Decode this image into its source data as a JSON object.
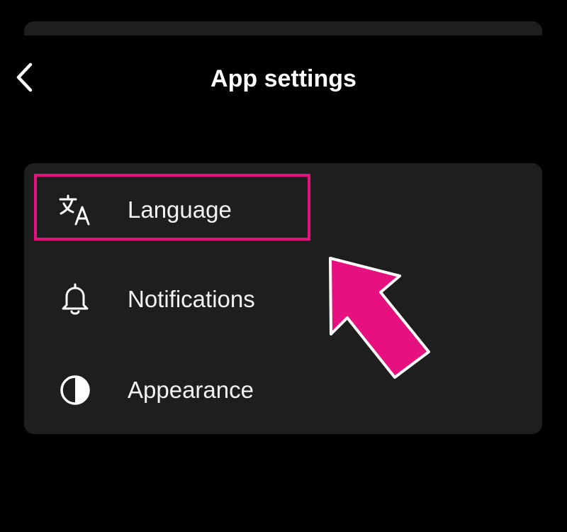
{
  "header": {
    "title": "App settings",
    "back_icon": "chevron-left-icon"
  },
  "settings": {
    "items": [
      {
        "label": "Language",
        "icon": "translate-icon"
      },
      {
        "label": "Notifications",
        "icon": "bell-icon"
      },
      {
        "label": "Appearance",
        "icon": "half-circle-contrast-icon"
      }
    ]
  },
  "annotation": {
    "highlight_color": "#e6107e",
    "arrow_color": "#e6107e",
    "arrow_icon": "pointer-arrow-icon"
  },
  "colors": {
    "background": "#000000",
    "card": "#1e1e1e",
    "text": "#ffffff"
  }
}
